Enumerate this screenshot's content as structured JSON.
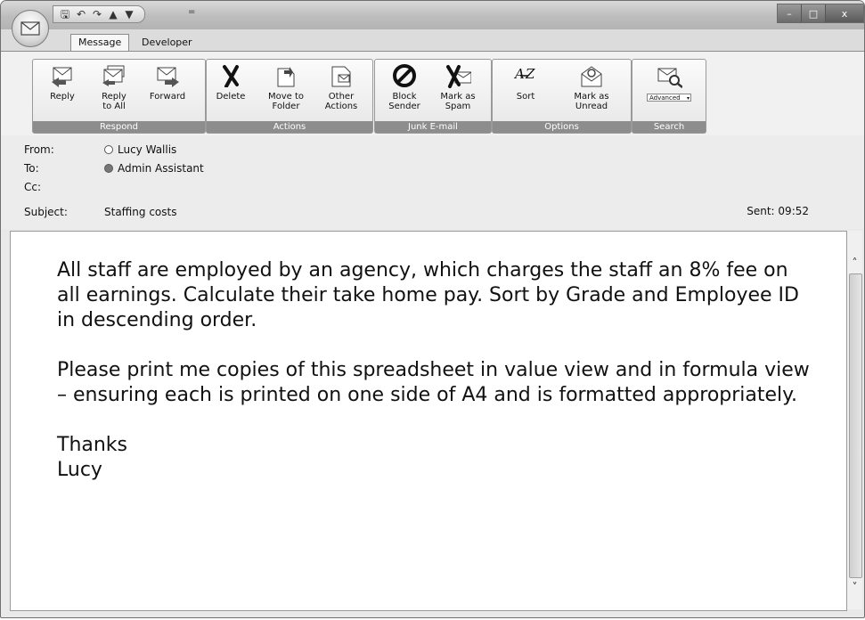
{
  "quick_access": {
    "icons": [
      "save-icon",
      "undo-icon",
      "redo-icon",
      "up-icon",
      "down-icon"
    ],
    "drop": "="
  },
  "window_controls": {
    "minimize": "–",
    "maximize": "□",
    "close": "x",
    "close_color": "#6d6d6d"
  },
  "tabs": [
    {
      "label": "Message",
      "active": true
    },
    {
      "label": "Developer",
      "active": false
    }
  ],
  "ribbon": {
    "groups": [
      {
        "label": "Respond",
        "buttons": [
          "Reply",
          "Reply\nto All",
          "Forward"
        ]
      },
      {
        "label": "Actions",
        "buttons": [
          "Delete",
          "Move to\nFolder",
          "Other\nActions"
        ]
      },
      {
        "label": "Junk E-mail",
        "buttons": [
          "Block\nSender",
          "Mark as\nSpam"
        ]
      },
      {
        "label": "Options",
        "buttons": [
          "Sort",
          "Mark as\nUnread"
        ]
      },
      {
        "label": "Search",
        "buttons": [
          "Advanced"
        ]
      }
    ]
  },
  "header": {
    "from_label": "From:",
    "from_value": "Lucy Wallis",
    "to_label": "To:",
    "to_value": "Admin Assistant",
    "cc_label": "Cc:",
    "cc_value": "",
    "subject_label": "Subject:",
    "subject_value": "Staffing costs",
    "sent": "Sent: 09:52"
  },
  "message": {
    "para1": "All staff are employed by an agency, which charges the staff an 8% fee on all earnings. Calculate their take home pay. Sort by Grade and Employee ID in descending order.",
    "para2": "Please print me copies of this spreadsheet in value view and in formula view – ensuring each is printed on one side of A4 and is formatted appropriately.",
    "sign1": "Thanks",
    "sign2": "Lucy"
  }
}
